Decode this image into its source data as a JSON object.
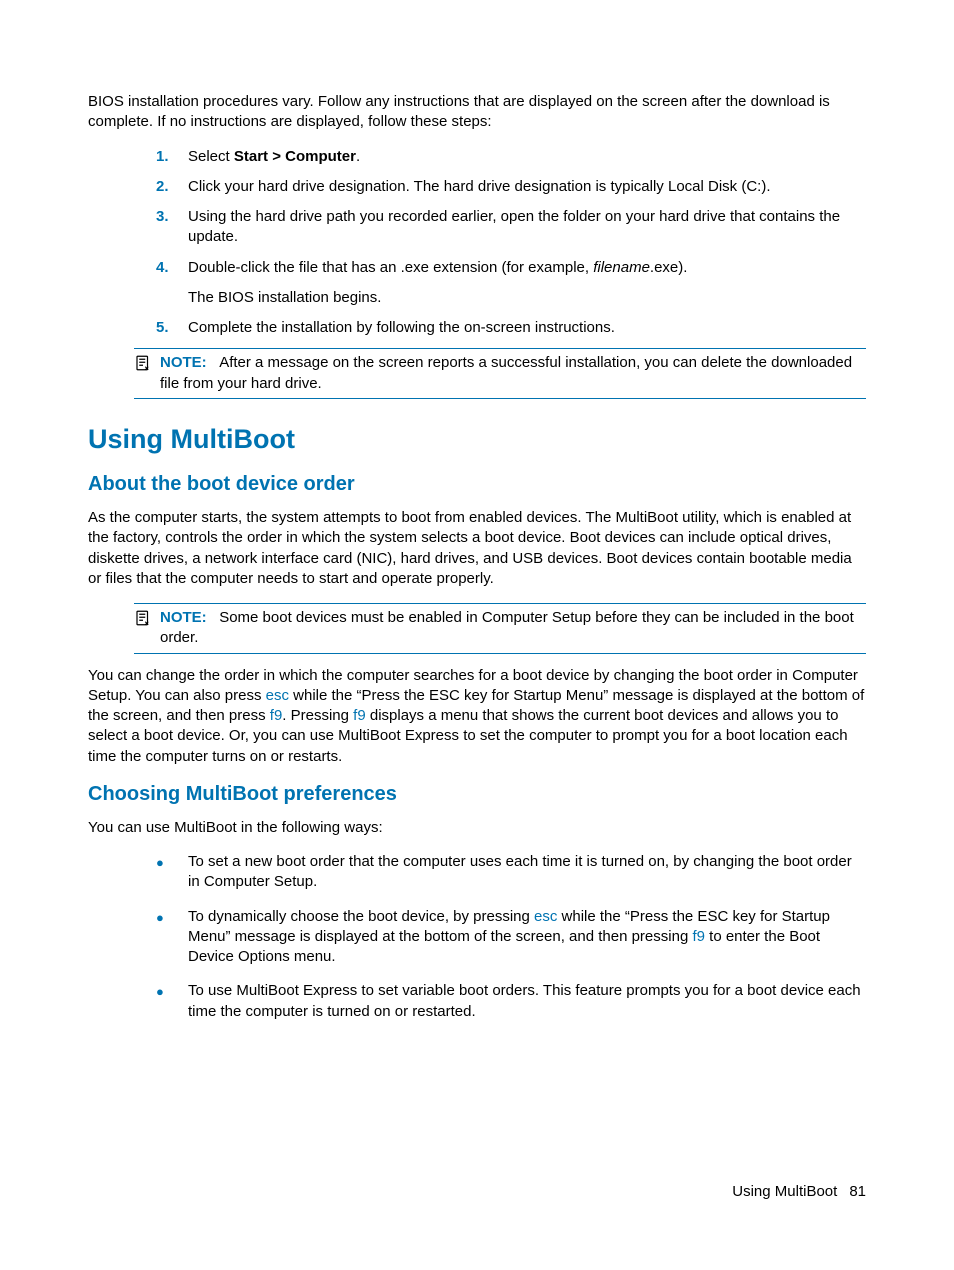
{
  "intro": "BIOS installation procedures vary. Follow any instructions that are displayed on the screen after the download is complete. If no instructions are displayed, follow these steps:",
  "steps": {
    "n1": "1.",
    "s1_pre": "Select ",
    "s1_bold": "Start > Computer",
    "s1_post": ".",
    "n2": "2.",
    "s2": "Click your hard drive designation. The hard drive designation is typically Local Disk (C:).",
    "n3": "3.",
    "s3": "Using the hard drive path you recorded earlier, open the folder on your hard drive that contains the update.",
    "n4": "4.",
    "s4_pre": "Double-click the file that has an .exe extension (for example, ",
    "s4_italic": "filename",
    "s4_post": ".exe).",
    "s4_sub": "The BIOS installation begins.",
    "n5": "5.",
    "s5": "Complete the installation by following the on-screen instructions."
  },
  "note1": {
    "label": "NOTE:",
    "text": "After a message on the screen reports a successful installation, you can delete the downloaded file from your hard drive."
  },
  "h1": "Using MultiBoot",
  "h2a": "About the boot device order",
  "p2": "As the computer starts, the system attempts to boot from enabled devices. The MultiBoot utility, which is enabled at the factory, controls the order in which the system selects a boot device. Boot devices can include optical drives, diskette drives, a network interface card (NIC), hard drives, and USB devices. Boot devices contain bootable media or files that the computer needs to start and operate properly.",
  "note2": {
    "label": "NOTE:",
    "text": "Some boot devices must be enabled in Computer Setup before they can be included in the boot order."
  },
  "p3": {
    "a": "You can change the order in which the computer searches for a boot device by changing the boot order in Computer Setup. You can also press ",
    "k1": "esc",
    "b": " while the “Press the ESC key for Startup Menu” message is displayed at the bottom of the screen, and then press ",
    "k2": "f9",
    "c": ". Pressing ",
    "k3": "f9",
    "d": " displays a menu that shows the current boot devices and allows you to select a boot device. Or, you can use MultiBoot Express to set the computer to prompt you for a boot location each time the computer turns on or restarts."
  },
  "h2b": "Choosing MultiBoot preferences",
  "p4": "You can use MultiBoot in the following ways:",
  "bullets": {
    "b1": "To set a new boot order that the computer uses each time it is turned on, by changing the boot order in Computer Setup.",
    "b2a": "To dynamically choose the boot device, by pressing ",
    "b2k1": "esc",
    "b2b": " while the “Press the ESC key for Startup Menu” message is displayed at the bottom of the screen, and then pressing ",
    "b2k2": "f9",
    "b2c": " to enter the Boot Device Options menu.",
    "b3": "To use MultiBoot Express to set variable boot orders. This feature prompts you for a boot device each time the computer is turned on or restarted."
  },
  "footer": {
    "title": "Using MultiBoot",
    "page": "81"
  }
}
